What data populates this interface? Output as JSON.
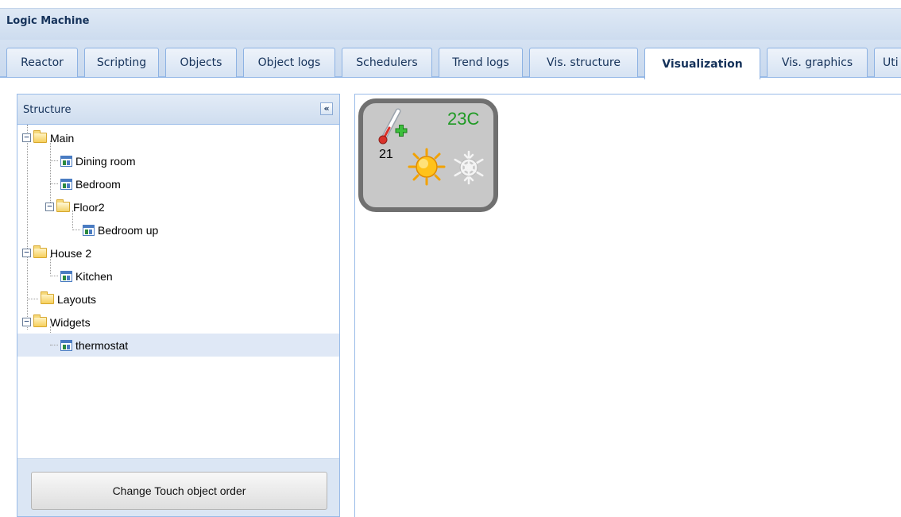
{
  "app": {
    "title": "Logic Machine"
  },
  "tabs": [
    {
      "label": "Reactor",
      "active": false
    },
    {
      "label": "Scripting",
      "active": false
    },
    {
      "label": "Objects",
      "active": false
    },
    {
      "label": "Object logs",
      "active": false
    },
    {
      "label": "Schedulers",
      "active": false
    },
    {
      "label": "Trend logs",
      "active": false
    },
    {
      "label": "Vis. structure",
      "active": false
    },
    {
      "label": "Visualization",
      "active": true
    },
    {
      "label": "Vis. graphics",
      "active": false
    },
    {
      "label": "Uti",
      "active": false
    }
  ],
  "structure": {
    "title": "Structure",
    "collapse_glyph": "«",
    "items": [
      {
        "label": "Main",
        "type": "folder",
        "expanded": true
      },
      {
        "label": "Dining room",
        "type": "page"
      },
      {
        "label": "Bedroom",
        "type": "page"
      },
      {
        "label": "Floor2",
        "type": "folder",
        "expanded": true
      },
      {
        "label": "Bedroom up",
        "type": "page"
      },
      {
        "label": "House 2",
        "type": "folder",
        "expanded": true
      },
      {
        "label": "Kitchen",
        "type": "page"
      },
      {
        "label": "Layouts",
        "type": "folder"
      },
      {
        "label": "Widgets",
        "type": "folder",
        "expanded": true
      },
      {
        "label": "thermostat",
        "type": "page",
        "selected": true
      }
    ],
    "order_button_label": "Change Touch object order"
  },
  "widget": {
    "current_temperature": "23C",
    "setpoint": "21",
    "icons": [
      "thermometer-plus-icon",
      "sun-icon",
      "snowflake-icon"
    ]
  },
  "colors": {
    "accent": "#99bbe8",
    "selection": "#dfe8f6",
    "temperature_text": "#1f9a24"
  }
}
